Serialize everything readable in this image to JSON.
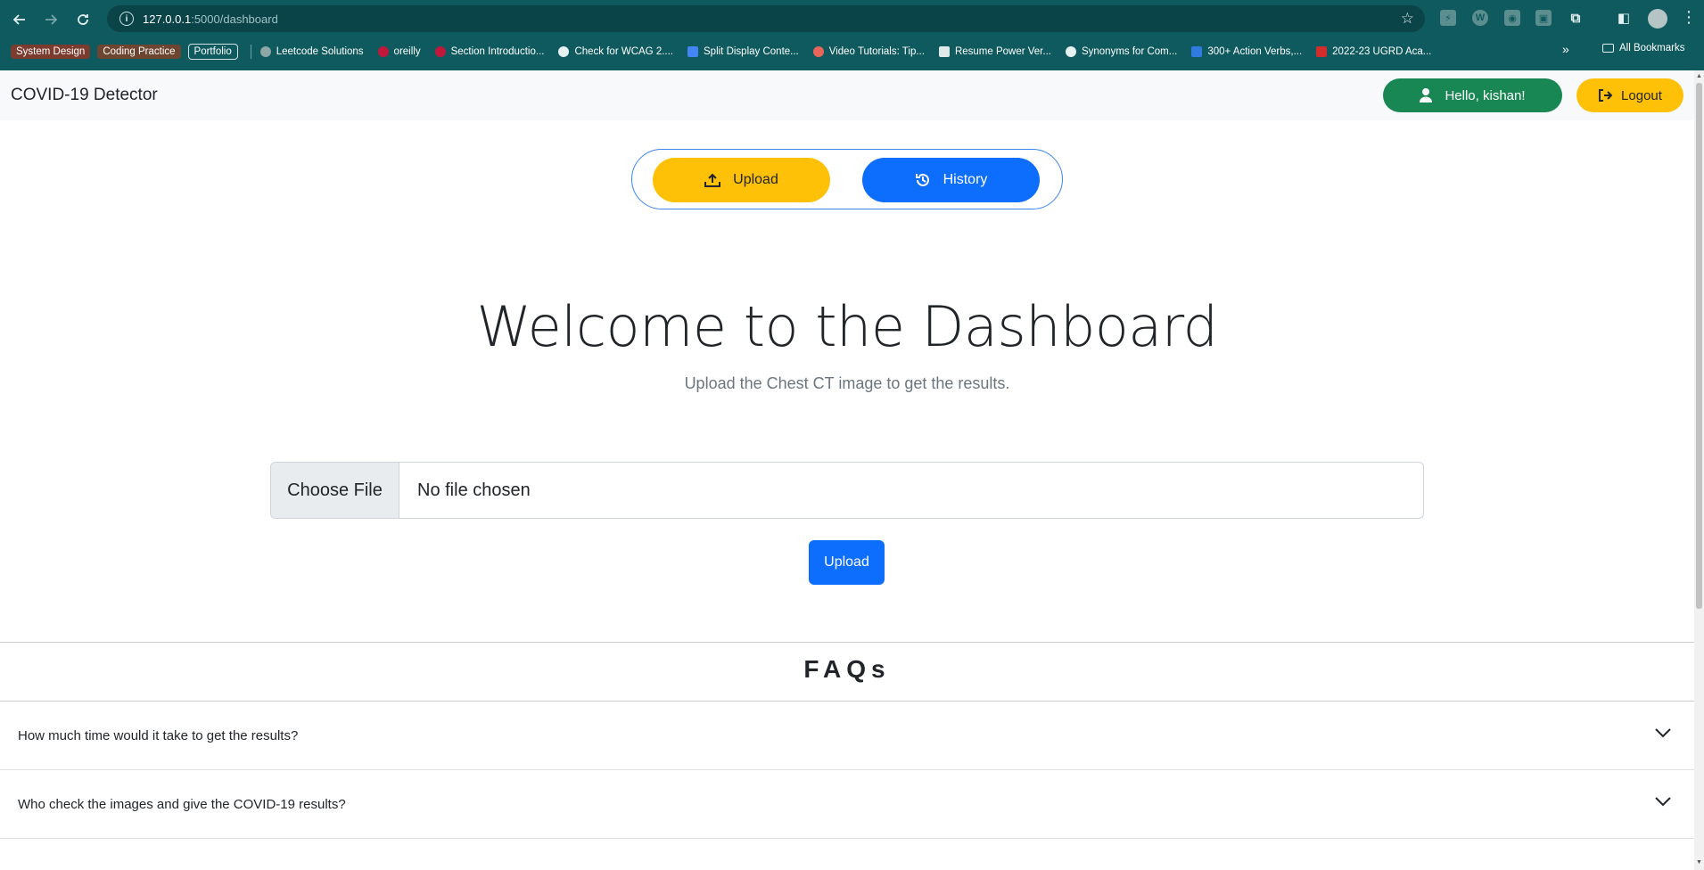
{
  "browser": {
    "url_host": "127.0.0.1",
    "url_path": ":5000/dashboard",
    "bookmarks_tags": [
      "System Design",
      "Coding Practice",
      "Portfolio"
    ],
    "bookmarks": [
      "Leetcode Solutions",
      "oreilly",
      "Section Introductio...",
      "Check for WCAG 2....",
      "Split Display Conte...",
      "Video Tutorials: Tip...",
      "Resume Power Ver...",
      "Synonyms for Com...",
      "300+ Action Verbs,...",
      "2022-23 UGRD Aca..."
    ],
    "more_label": "»",
    "all_bookmarks": "All Bookmarks"
  },
  "navbar": {
    "brand": "COVID-19 Detector",
    "hello": "Hello, kishan!",
    "logout": "Logout"
  },
  "tabs": {
    "upload": "Upload",
    "history": "History"
  },
  "hero": {
    "title": "Welcome to the Dashboard",
    "subtitle": "Upload the Chest CT image to get the results."
  },
  "file_input": {
    "button": "Choose File",
    "status": "No file chosen"
  },
  "submit": "Upload",
  "faq": {
    "title": "FAQs",
    "items": [
      "How much time would it take to get the results?",
      "Who check the images and give the COVID-19 results?"
    ]
  },
  "colors": {
    "chrome": "#0e5a5e",
    "success": "#198754",
    "warning": "#ffc107",
    "primary": "#0d6efd"
  }
}
